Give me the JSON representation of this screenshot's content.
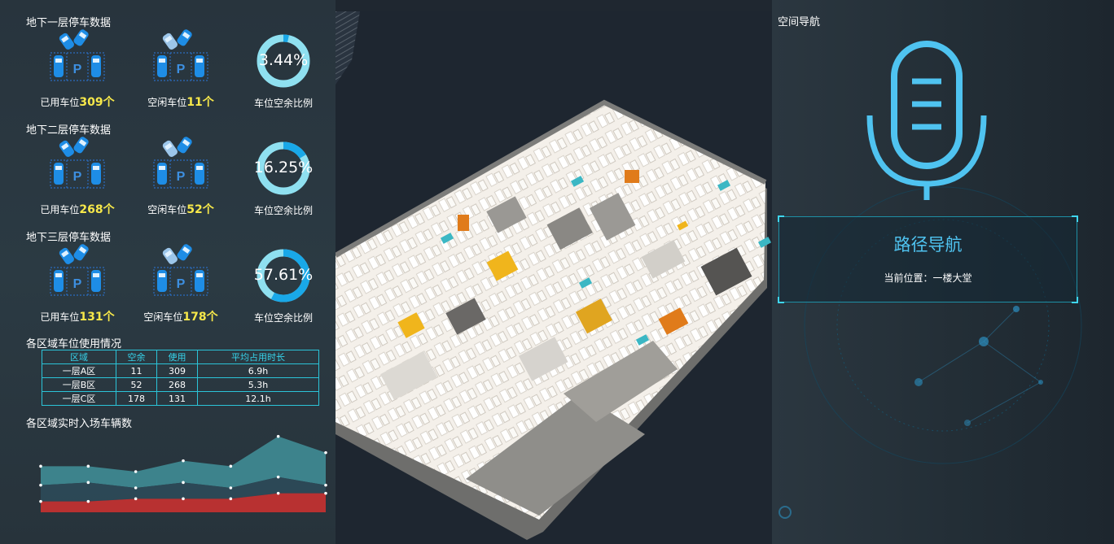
{
  "floors": [
    {
      "title": "地下一层停车数据",
      "used_label": "已用车位",
      "used_value": "309个",
      "free_label": "空闲车位",
      "free_value": "11个",
      "ratio_text": "3.44%",
      "ratio": 0.0344,
      "ratio_label": "车位空余比例"
    },
    {
      "title": "地下二层停车数据",
      "used_label": "已用车位",
      "used_value": "268个",
      "free_label": "空闲车位",
      "free_value": "52个",
      "ratio_text": "16.25%",
      "ratio": 0.1625,
      "ratio_label": "车位空余比例"
    },
    {
      "title": "地下三层停车数据",
      "used_label": "已用车位",
      "used_value": "131个",
      "free_label": "空闲车位",
      "free_value": "178个",
      "ratio_text": "57.61%",
      "ratio": 0.5761,
      "ratio_label": "车位空余比例"
    }
  ],
  "usage_table": {
    "title": "各区域车位使用情况",
    "headers": [
      "区域",
      "空余",
      "使用",
      "平均占用时长"
    ],
    "rows": [
      [
        "一层A区",
        "11",
        "309",
        "6.9h"
      ],
      [
        "一层B区",
        "52",
        "268",
        "5.3h"
      ],
      [
        "一层C区",
        "178",
        "131",
        "12.1h"
      ]
    ]
  },
  "flow_chart": {
    "title": "各区域实时入场车辆数"
  },
  "chart_data": {
    "type": "area",
    "title": "各区域实时入场车辆数",
    "x": [
      0,
      1,
      2,
      3,
      4,
      5,
      6
    ],
    "series": [
      {
        "values": [
          4,
          4,
          5,
          5,
          5,
          7,
          7
        ],
        "color": "#c43131"
      },
      {
        "values": [
          10,
          11,
          9,
          11,
          9,
          13,
          10
        ],
        "color": "#2d4a58"
      },
      {
        "values": [
          17,
          17,
          15,
          19,
          17,
          28,
          22
        ],
        "color": "#3f8a92"
      }
    ],
    "ylim": [
      0,
      30
    ]
  },
  "navigation": {
    "panel_title": "空间导航",
    "button_label": "路径导航",
    "current_location": "当前位置：一楼大堂"
  },
  "colors": {
    "accent": "#4fc3f0",
    "highlight": "#f7e84a",
    "table_border": "#2bc4d8"
  }
}
